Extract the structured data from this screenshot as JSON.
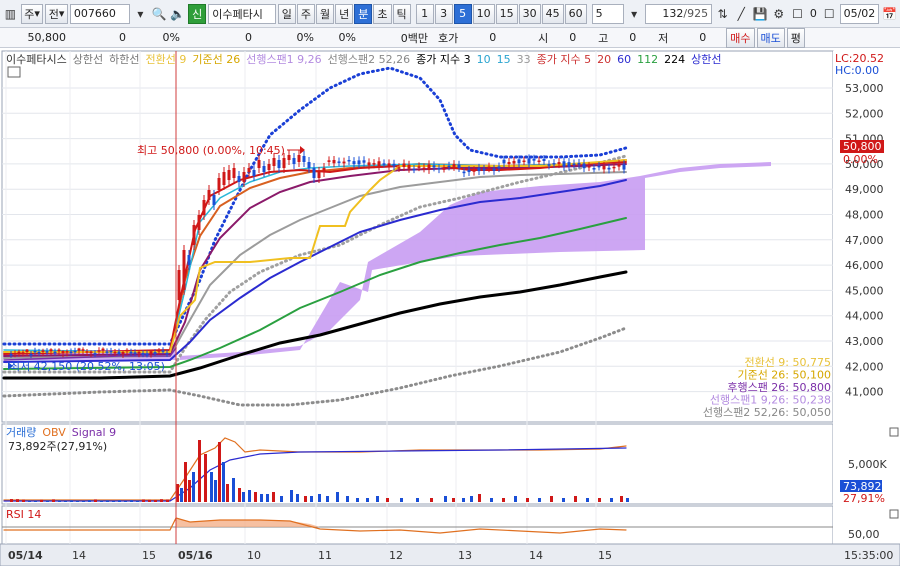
{
  "toolbar": {
    "market_select": "주",
    "chart_type_select": "전",
    "stock_code": "007660",
    "new_badge": "신",
    "stock_name": "이수페타시",
    "period_buttons": [
      "일",
      "주",
      "월",
      "년",
      "분",
      "초",
      "틱"
    ],
    "minute_buttons": [
      "1",
      "3",
      "5",
      "10",
      "15",
      "30",
      "45",
      "60"
    ],
    "interval_value": "5",
    "count_value": "132",
    "count_total": "/925",
    "checkbox_value": "0",
    "date_value": "05/02"
  },
  "quote_bar": {
    "price": "50,800",
    "change": "0",
    "change_pct": "0%",
    "volume": "0",
    "vol_pct": "0%",
    "val_pct": "0%",
    "amount": "0백만",
    "hoga_label": "호가",
    "hoga_value": "0",
    "open_label": "시",
    "open_value": "0",
    "high_label": "고",
    "high_value": "0",
    "low_label": "저",
    "low_value": "0",
    "buy_button": "매수",
    "sell_button": "매도",
    "eval_button": "평"
  },
  "price_panel": {
    "legend": [
      {
        "text": "이수페타시스",
        "color": "#333333"
      },
      {
        "text": "상한선",
        "color": "#777777"
      },
      {
        "text": "하한선",
        "color": "#777777"
      },
      {
        "text": "전환선 9",
        "color": "#e8c23a"
      },
      {
        "text": "기준선 26",
        "color": "#d6a700"
      },
      {
        "text": "선행스팬1 9,26",
        "color": "#b38be0"
      },
      {
        "text": "선행스팬2 52,26",
        "color": "#888888"
      },
      {
        "text": "종가 지수 3",
        "color": "#000000"
      },
      {
        "text": "10",
        "color": "#2aa4d0"
      },
      {
        "text": "15",
        "color": "#2aa4d0"
      },
      {
        "text": "33",
        "color": "#999999"
      },
      {
        "text": "종가 지수 5",
        "color": "#cc3333"
      },
      {
        "text": "20",
        "color": "#cc3333"
      },
      {
        "text": "60",
        "color": "#2b2bd0"
      },
      {
        "text": "112",
        "color": "#2aa040"
      },
      {
        "text": "224",
        "color": "#000000"
      },
      {
        "text": "상한선",
        "color": "#2b2bd0"
      }
    ],
    "lc_label": "LC:20.52",
    "hc_label": "HC:0.00",
    "y_ticks": [
      "53,000",
      "52,000",
      "51,000",
      "50,000",
      "49,000",
      "48,000",
      "47,000",
      "46,000",
      "45,000",
      "44,000",
      "43,000",
      "42,000",
      "41,000"
    ],
    "current_price_tag": "50,800",
    "current_pct_tag": "0.00%",
    "high_annotation": "최고 50,800 (0.00%, 10:45)",
    "low_annotation": "최저 42,150 (20.52%, 13:05)",
    "right_legend": [
      {
        "text": "전환선 9: 50,775",
        "color": "#e8c23a"
      },
      {
        "text": "기준선 26: 50,100",
        "color": "#d6a700"
      },
      {
        "text": "후행스팬 26: 50,800",
        "color": "#7b2fa8"
      },
      {
        "text": "선행스팬1 9,26: 50,238",
        "color": "#b38be0"
      },
      {
        "text": "선행스팬2 52,26: 50,050",
        "color": "#888888"
      }
    ]
  },
  "volume_panel": {
    "legend": [
      {
        "text": "거래량",
        "color": "#2b6fd6"
      },
      {
        "text": "OBV",
        "color": "#e07020"
      },
      {
        "text": "Signal 9",
        "color": "#7b2fa8"
      }
    ],
    "info": "73,892주(27,91%)",
    "y_tick": "5,000K",
    "value_tag": "73,892",
    "pct_tag": "27,91%"
  },
  "rsi_panel": {
    "legend": "RSI 14",
    "y_tick": "50,00"
  },
  "x_axis": {
    "labels": [
      "05/14",
      "14",
      "15",
      "05/16",
      "10",
      "11",
      "12",
      "13",
      "14",
      "15"
    ],
    "time_label": "15:35:00"
  },
  "colors": {
    "up": "#d01818",
    "down": "#1a4fd6",
    "cloud": "#c89cf2",
    "accent": "#2d6fd6"
  }
}
